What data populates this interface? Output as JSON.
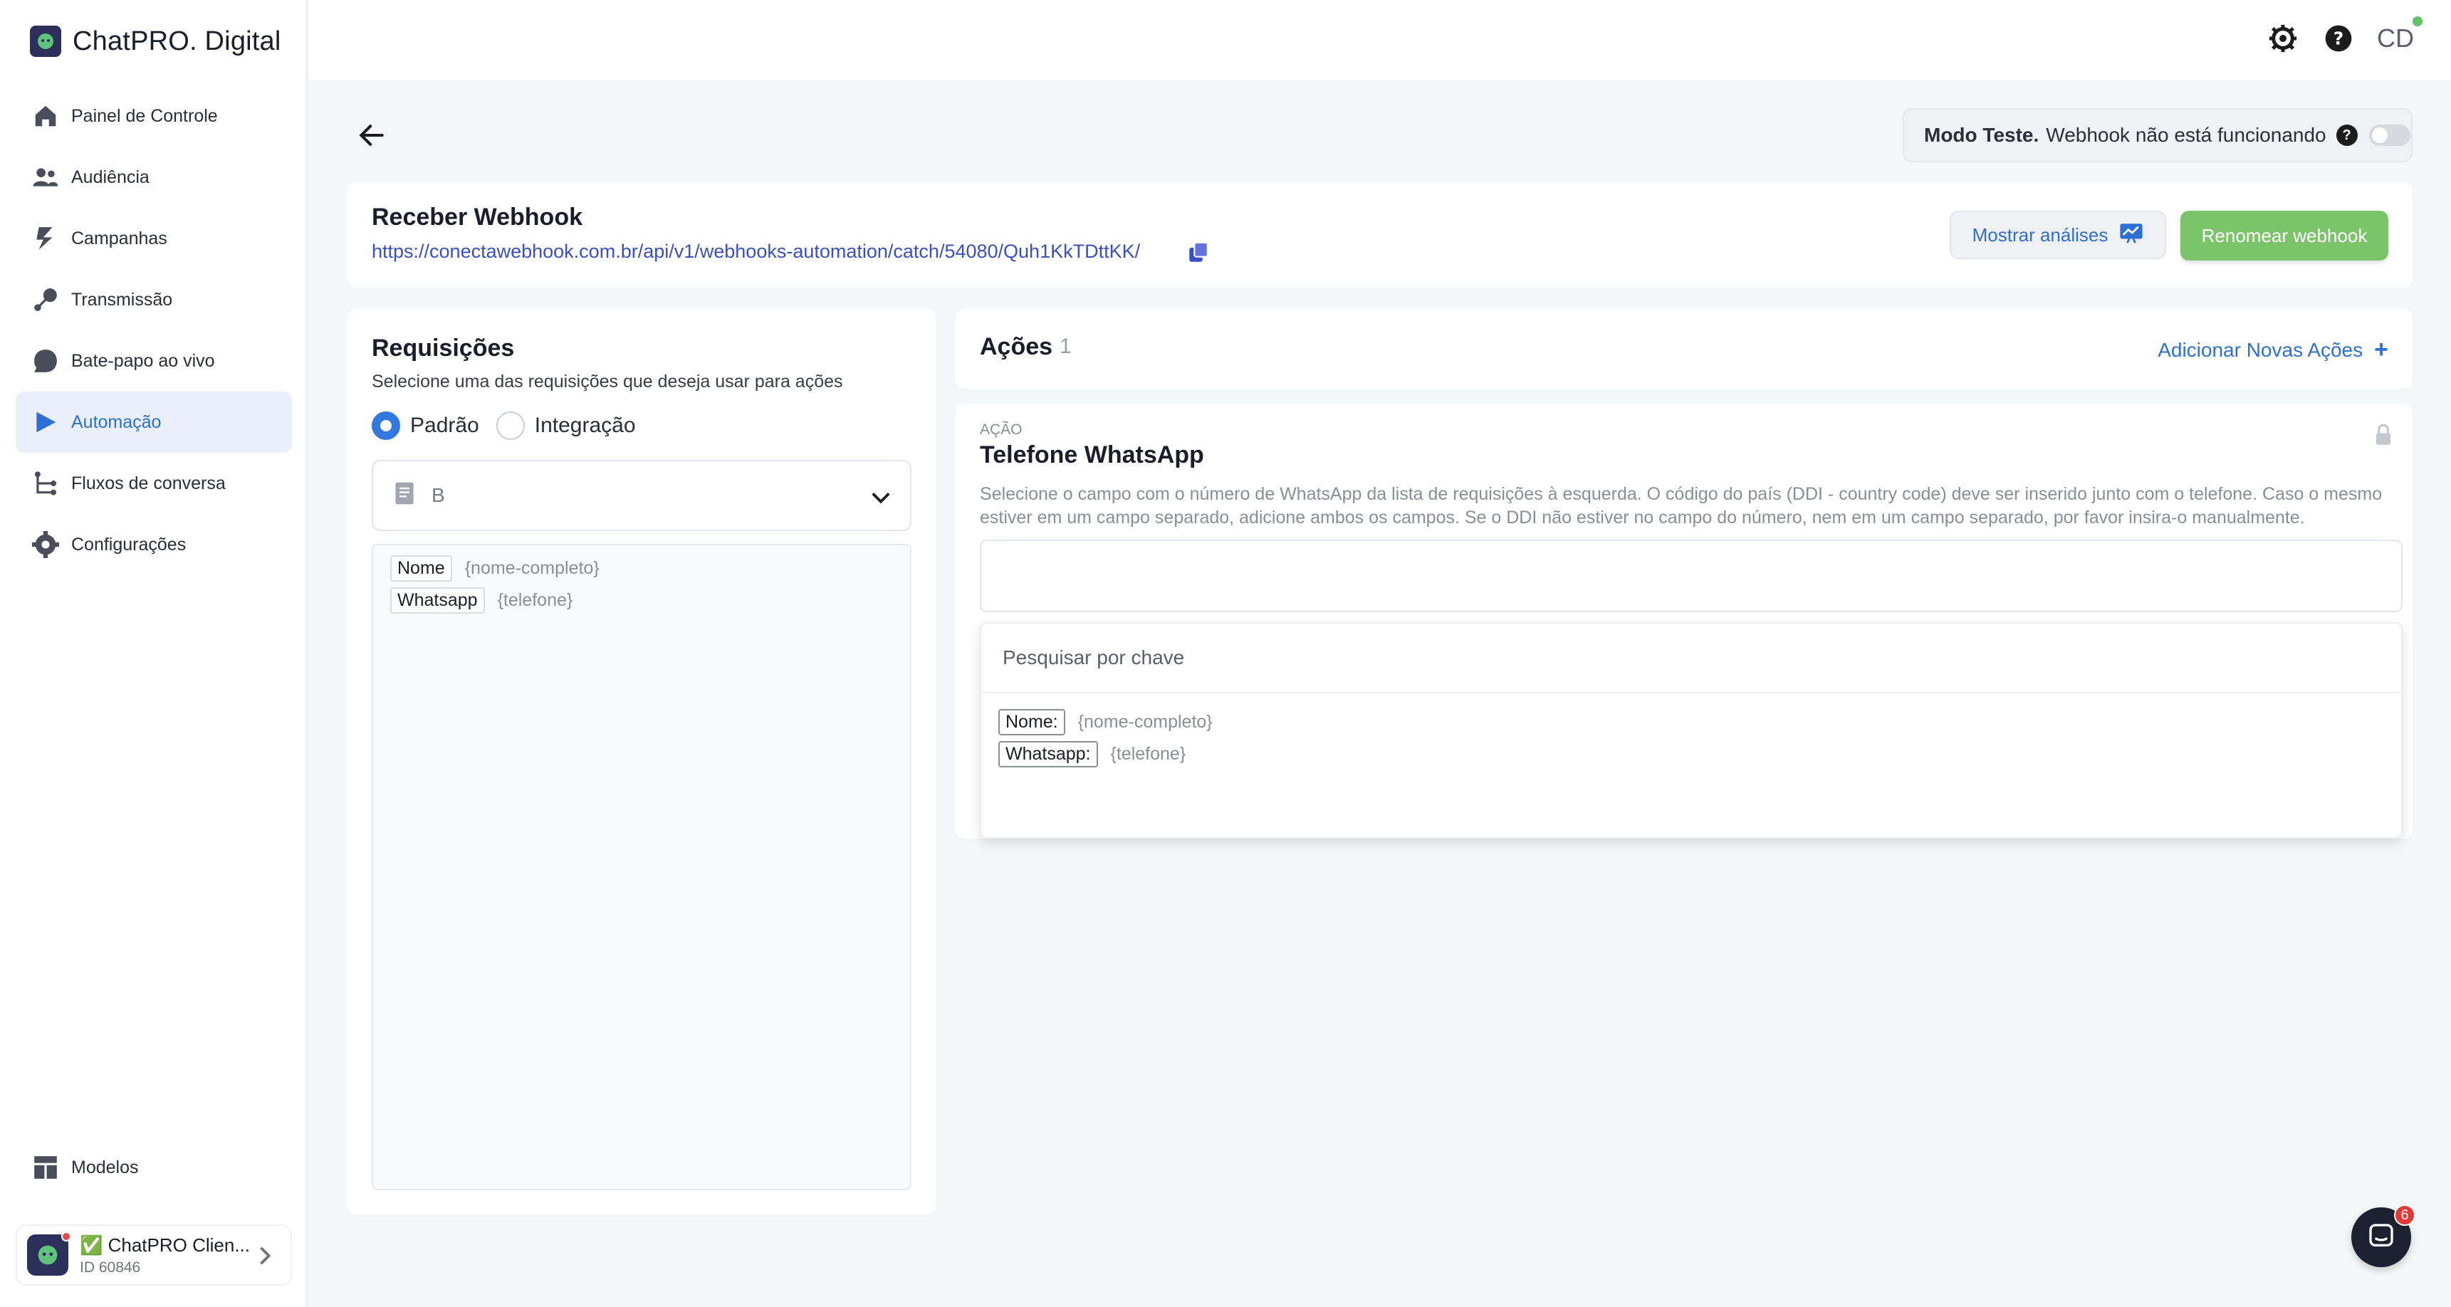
{
  "sidebar": {
    "brand": "ChatPRO. Digital",
    "items": [
      {
        "label": "Painel de Controle",
        "icon": "home-icon"
      },
      {
        "label": "Audiência",
        "icon": "users-icon"
      },
      {
        "label": "Campanhas",
        "icon": "campaign-icon"
      },
      {
        "label": "Transmissão",
        "icon": "broadcast-icon"
      },
      {
        "label": "Bate-papo ao vivo",
        "icon": "chat-icon"
      },
      {
        "label": "Automação",
        "icon": "automation-icon",
        "active": true
      },
      {
        "label": "Fluxos de conversa",
        "icon": "flow-icon"
      },
      {
        "label": "Configurações",
        "icon": "settings-icon"
      }
    ],
    "bottom_item": {
      "label": "Modelos",
      "icon": "templates-icon"
    },
    "account": {
      "name": "✅ ChatPRO Clien...",
      "id": "ID 60846"
    }
  },
  "topbar": {
    "avatar_initials": "CD"
  },
  "test_mode": {
    "label": "Modo Teste.",
    "status": "Webhook não está funcionando",
    "enabled": false
  },
  "webhook": {
    "title": "Receber Webhook",
    "url": "https://conectawebhook.com.br/api/v1/webhooks-automation/catch/54080/Quh1KkTDttKK/",
    "analytics_button": "Mostrar análises",
    "rename_button": "Renomear webhook"
  },
  "requests": {
    "title": "Requisições",
    "subtitle": "Selecione uma das requisições que deseja usar para ações",
    "options": [
      {
        "label": "Padrão",
        "selected": true
      },
      {
        "label": "Integração",
        "selected": false
      }
    ],
    "select_value": "B",
    "fields": [
      {
        "key": "Nome",
        "value": "{nome-completo}"
      },
      {
        "key": "Whatsapp",
        "value": "{telefone}"
      }
    ]
  },
  "actions": {
    "title": "Ações",
    "count": "1",
    "add_label": "Adicionar Novas Ações"
  },
  "action": {
    "eyebrow": "AÇÃO",
    "title": "Telefone WhatsApp",
    "description": "Selecione o campo com o número de WhatsApp da lista de requisições à esquerda. O código do país (DDI - country code) deve ser inserido junto com o telefone. Caso o mesmo estiver em um campo separado, adicione ambos os campos. Se o DDI não estiver no campo do número, nem em um campo separado, por favor insira-o manualmente.",
    "search_placeholder": "Pesquisar por chave",
    "options": [
      {
        "key": "Nome:",
        "value": "{nome-completo}"
      },
      {
        "key": "Whatsapp:",
        "value": "{telefone}"
      }
    ]
  },
  "chat_widget": {
    "badge": "6"
  }
}
